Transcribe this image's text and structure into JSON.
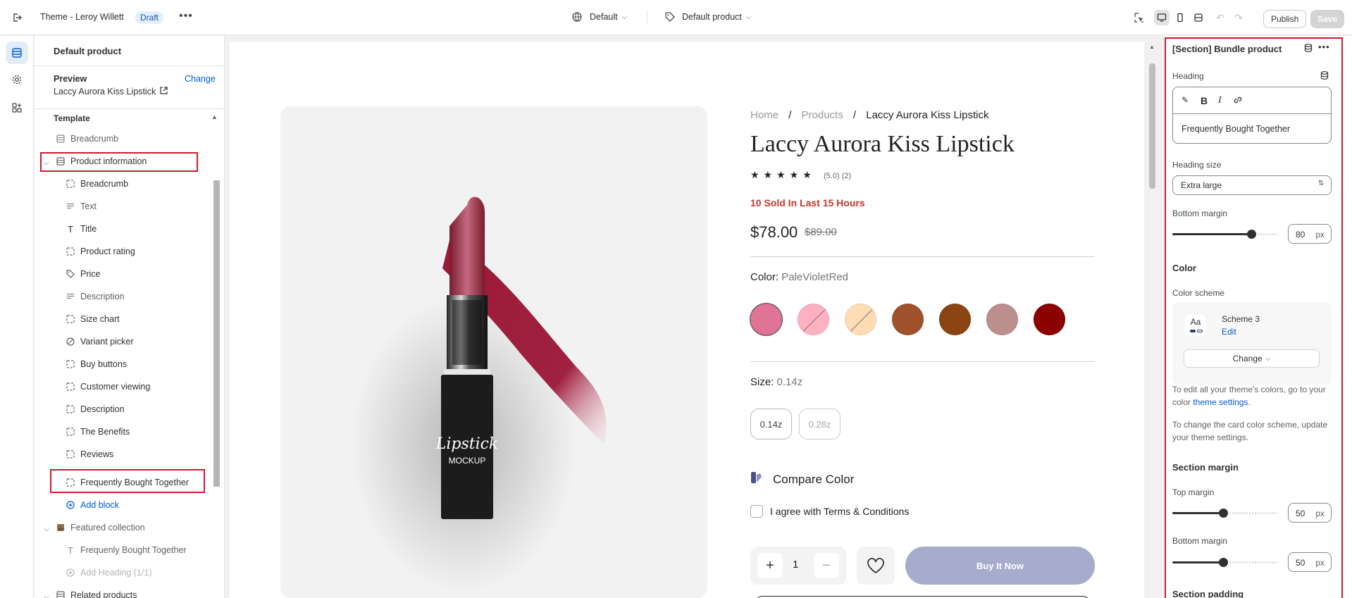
{
  "topbar": {
    "theme_name": "Theme - Leroy Willett",
    "status_badge": "Draft",
    "template_select": "Default",
    "product_select": "Default product",
    "publish_label": "Publish",
    "save_label": "Save"
  },
  "sidebar": {
    "title": "Default product",
    "preview_label": "Preview",
    "change_link": "Change",
    "preview_product": "Laccy Aurora Kiss Lipstick",
    "template_label": "Template",
    "items": [
      {
        "label": "Breadcrumb",
        "icon": "section-icon"
      },
      {
        "label": "Product information",
        "icon": "section-icon"
      },
      {
        "label": "Breadcrumb",
        "icon": "block-icon"
      },
      {
        "label": "Text",
        "icon": "text-icon"
      },
      {
        "label": "Title",
        "icon": "title-icon"
      },
      {
        "label": "Product rating",
        "icon": "block-icon"
      },
      {
        "label": "Price",
        "icon": "price-icon"
      },
      {
        "label": "Description",
        "icon": "text-icon"
      },
      {
        "label": "Size chart",
        "icon": "block-icon"
      },
      {
        "label": "Variant picker",
        "icon": "variant-icon"
      },
      {
        "label": "Buy buttons",
        "icon": "block-icon"
      },
      {
        "label": "Customer viewing",
        "icon": "block-icon"
      },
      {
        "label": "Description",
        "icon": "block-icon"
      },
      {
        "label": "The Benefits",
        "icon": "block-icon"
      },
      {
        "label": "Reviews",
        "icon": "block-icon"
      },
      {
        "label": "Frequently Bought Together",
        "icon": "block-icon"
      },
      {
        "label": "Add block",
        "icon": "plus-circle-icon"
      },
      {
        "label": "Featured collection",
        "icon": "image-section-icon"
      },
      {
        "label": "Frequenly Bought Together",
        "icon": "title-icon"
      },
      {
        "label": "Add Heading (1/1)",
        "icon": "plus-circle-icon"
      },
      {
        "label": "Related products",
        "icon": "section-icon"
      }
    ]
  },
  "preview": {
    "breadcrumb": {
      "home": "Home",
      "products": "Products",
      "current": "Laccy Aurora Kiss Lipstick",
      "sep": "/"
    },
    "title": "Laccy Aurora Kiss Lipstick",
    "stars": "★★★★★",
    "rating_value": "(5.0)",
    "rating_count": "(2)",
    "sold_text": "10 Sold In Last 15 Hours",
    "price": "$78.00",
    "compare_price": "$89.00",
    "color_label": "Color:",
    "color_value": "PaleVioletRed",
    "swatches": [
      "#df7497",
      "#ffb0c1",
      "#ffdcb4",
      "#a0522d",
      "#8b4513",
      "#bc8f8f",
      "#8b0000"
    ],
    "size_label": "Size:",
    "size_value": "0.14z",
    "sizes": [
      "0.14z",
      "0.28z"
    ],
    "compare_color": "Compare Color",
    "agree_text": "I agree with Terms & Conditions",
    "quantity": "1",
    "buy_now": "Buy It Now",
    "mockup_script": "Lipstick",
    "mockup_caption": "MOCKUP"
  },
  "panel": {
    "section_title": "[Section] Bundle product",
    "heading_label": "Heading",
    "heading_value": "Frequently Bought Together",
    "heading_size_label": "Heading size",
    "heading_size_value": "Extra large",
    "bottom_margin_label": "Bottom margin",
    "bottom_margin_value": "80",
    "unit": "px",
    "color_title": "Color",
    "color_scheme_label": "Color scheme",
    "scheme_preview": "Aa",
    "scheme_name": "Scheme 3",
    "scheme_edit": "Edit",
    "scheme_change": "Change",
    "help1_pre": "To edit all your theme's colors, go to your color ",
    "help1_link": "theme settings",
    "help1_post": ".",
    "help2": "To change the card color scheme, update your theme settings.",
    "section_margin_title": "Section margin",
    "top_margin_label": "Top margin",
    "top_margin_value": "50",
    "section_bottom_margin_label": "Bottom margin",
    "section_bottom_margin_value": "50",
    "section_padding_title": "Section padding"
  },
  "colors": {
    "accent": "#005bd3",
    "highlight": "#d11a2a",
    "sold": "#c0392b",
    "buy_button": "#a7abcc"
  }
}
